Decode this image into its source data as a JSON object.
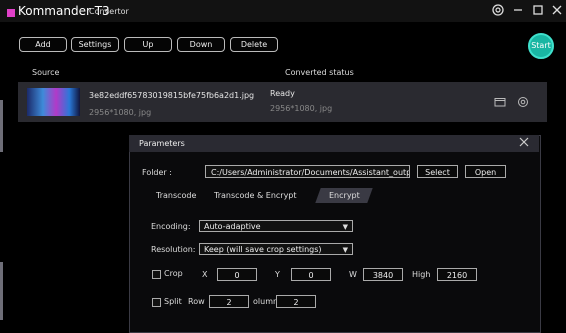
{
  "app": {
    "title": "Kommander T3",
    "subtitle": "Convertor"
  },
  "toolbar": {
    "add": "Add",
    "settings": "Settings",
    "up": "Up",
    "down": "Down",
    "delete": "Delete",
    "start": "Start"
  },
  "columns": {
    "source": "Source",
    "status": "Converted status"
  },
  "file": {
    "name": "3e82eddf65783019815bfe75fb6a2d1.jpg",
    "source_dims": "2956*1080, jpg",
    "status": "Ready",
    "output_dims": "2956*1080, jpg"
  },
  "dialog": {
    "title": "Parameters",
    "folder_label": "Folder :",
    "folder_value": "C:/Users/Administrator/Documents/Assistant_output",
    "select": "Select",
    "open": "Open",
    "tabs": [
      "Transcode",
      "Transcode & Encrypt",
      "Encrypt"
    ],
    "encoding_label": "Encoding:",
    "encoding_value": "Auto-adaptive",
    "resolution_label": "Resolution:",
    "resolution_value": "Keep (will save crop settings)",
    "crop_label": "Crop",
    "x_label": "X",
    "x_value": "0",
    "y_label": "Y",
    "y_value": "0",
    "w_label": "W",
    "w_value": "3840",
    "h_label": "High",
    "h_value": "2160",
    "split_label": "Split",
    "row_label": "Row",
    "row_value": "2",
    "column_label": "olumn",
    "column_value": "2"
  }
}
